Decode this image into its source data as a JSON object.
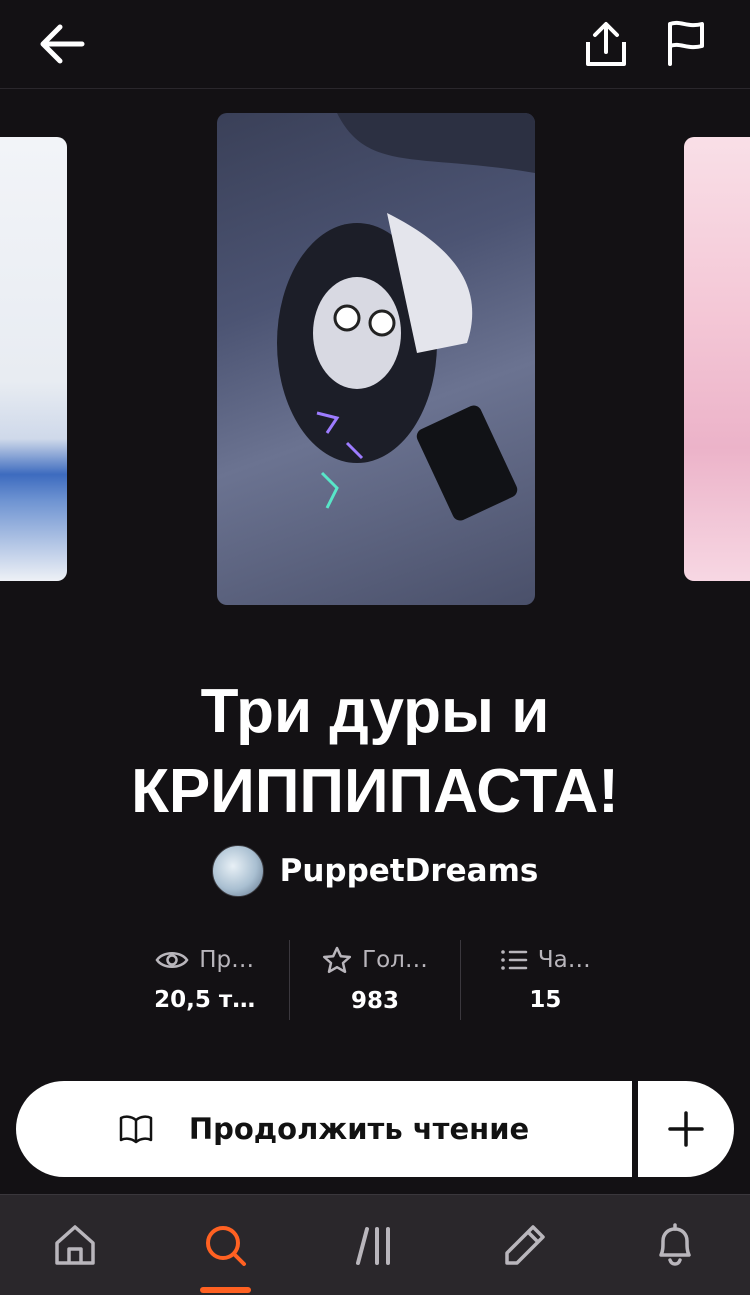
{
  "header": {
    "back_icon": "arrow-left-icon",
    "share_icon": "share-icon",
    "report_icon": "flag-icon"
  },
  "carousel": {
    "covers": [
      "cover-image",
      "cover-image",
      "cover-image"
    ]
  },
  "story": {
    "title_line1": "Три дуры и",
    "title_line2": "КРИППИПАСТА!",
    "author": "PuppetDreams"
  },
  "stats": [
    {
      "icon": "eye-icon",
      "label": "Пр…",
      "value": "20,5 т…"
    },
    {
      "icon": "star-icon",
      "label": "Гол…",
      "value": "983"
    },
    {
      "icon": "list-icon",
      "label": "Ча…",
      "value": "15"
    }
  ],
  "actions": {
    "read_label": "Продолжить чтение",
    "add_icon": "plus-icon"
  },
  "nav": {
    "items": [
      "home-icon",
      "search-icon",
      "library-icon",
      "write-icon",
      "bell-icon"
    ],
    "active": "search",
    "accent": "#ff6122"
  }
}
